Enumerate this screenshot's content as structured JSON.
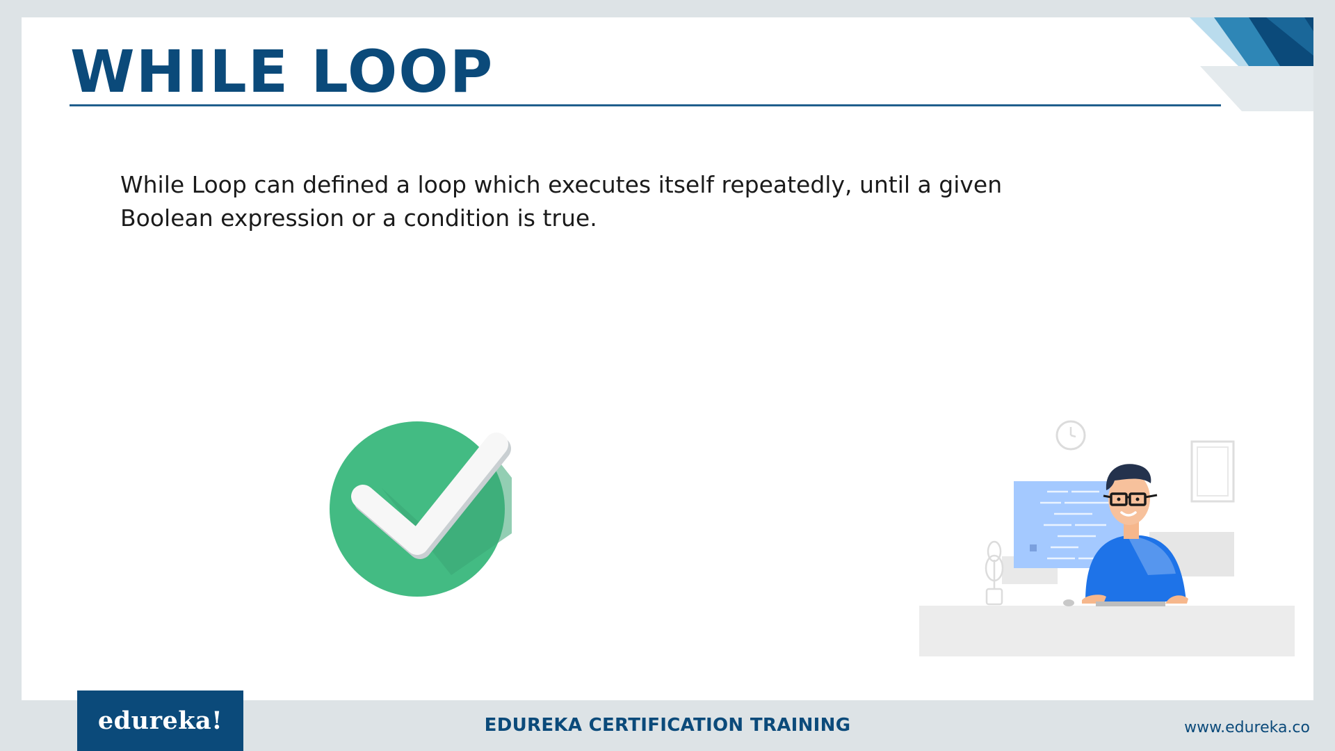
{
  "slide": {
    "title": "WHILE LOOP",
    "body": "While Loop can defined a loop which executes itself repeatedly, until a given Boolean expression or a condition is true."
  },
  "footer": {
    "logo_text": "edureka!",
    "center_text": "EDUREKA CERTIFICATION TRAINING",
    "url": "www.edureka.co"
  },
  "icons": {
    "check": "checkmark-circle-icon",
    "illustration": "developer-at-desk-illustration"
  },
  "colors": {
    "brand_blue": "#0b4a7a",
    "check_green": "#43bb83",
    "shirt_blue": "#1e73e8"
  }
}
